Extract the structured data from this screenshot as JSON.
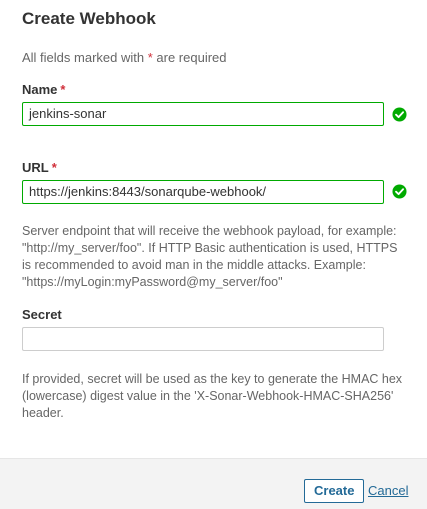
{
  "dialog": {
    "title": "Create Webhook",
    "required_note_prefix": "All fields marked with ",
    "required_note_star": "*",
    "required_note_suffix": " are required"
  },
  "fields": {
    "name": {
      "label": "Name",
      "required_star": "*",
      "value": "jenkins-sonar",
      "status": "valid",
      "status_icon": "check-circle-icon"
    },
    "url": {
      "label": "URL",
      "required_star": "*",
      "value": "https://jenkins:8443/sonarqube-webhook/",
      "status": "valid",
      "status_icon": "check-circle-icon",
      "help": "Server endpoint that will receive the webhook payload, for example: \"http://my_server/foo\". If HTTP Basic authentication is used, HTTPS is recommended to avoid man in the middle attacks. Example: \"https://myLogin:myPassword@my_server/foo\""
    },
    "secret": {
      "label": "Secret",
      "value": "",
      "help": "If provided, secret will be used as the key to generate the HMAC hex (lowercase) digest value in the 'X-Sonar-Webhook-HMAC-SHA256' header."
    }
  },
  "footer": {
    "create_label": "Create",
    "cancel_label": "Cancel"
  },
  "colors": {
    "valid": "#00aa00",
    "required_star": "#d02f3a",
    "link": "#236a97"
  }
}
